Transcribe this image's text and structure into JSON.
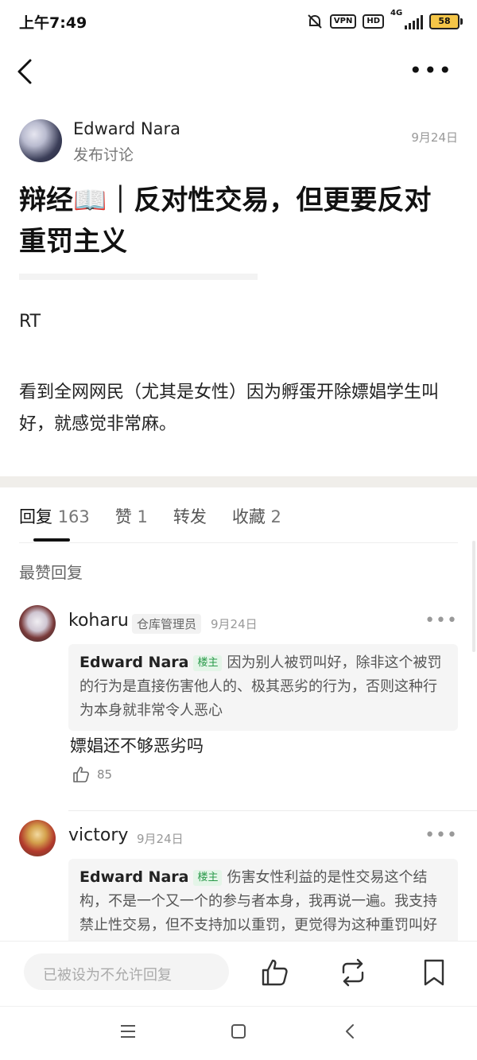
{
  "status": {
    "time": "上午7:49",
    "vpn": "VPN",
    "hd": "HD",
    "network": "4G",
    "battery": "58"
  },
  "post": {
    "author": "Edward Nara",
    "action": "发布讨论",
    "date": "9月24日",
    "title": "辩经📖｜反对性交易，但更要反对重罚主义",
    "body_line1": "RT",
    "body_line2": "看到全网网民（尤其是女性）因为孵蛋开除嫖娼学生叫好，就感觉非常麻。"
  },
  "tabs": [
    {
      "label": "回复",
      "count": "163"
    },
    {
      "label": "赞",
      "count": "1"
    },
    {
      "label": "转发",
      "count": ""
    },
    {
      "label": "收藏",
      "count": "2"
    }
  ],
  "section": "最赞回复",
  "comments": [
    {
      "name": "koharu",
      "badge": "仓库管理员",
      "date": "9月24日",
      "quote_author": "Edward Nara",
      "op_badge": "楼主",
      "quote_text": "因为别人被罚叫好，除非这个被罚的行为是直接伤害他人的、极其恶劣的行为，否则这种行为本身就非常令人恶心",
      "text": "嫖娼还不够恶劣吗",
      "likes": "85"
    },
    {
      "name": "victory",
      "badge": "",
      "date": "9月24日",
      "quote_author": "Edward Nara",
      "op_badge": "楼主",
      "quote_text": "伤害女性利益的是性交易这个结构，不是一个又一个的参与者本身，我再说一遍。我支持禁止性交易，但不支持加以重罚，更觉得为这种重罚叫好非常不立，你还有证明吗",
      "text": "",
      "likes": ""
    }
  ],
  "bottom": {
    "reply_placeholder": "已被设为不允许回复"
  },
  "icons": {
    "back": "chevron-left-icon",
    "more": "more-dots-icon",
    "like": "thumbs-up-icon",
    "repost": "repost-icon",
    "bookmark": "bookmark-icon"
  }
}
